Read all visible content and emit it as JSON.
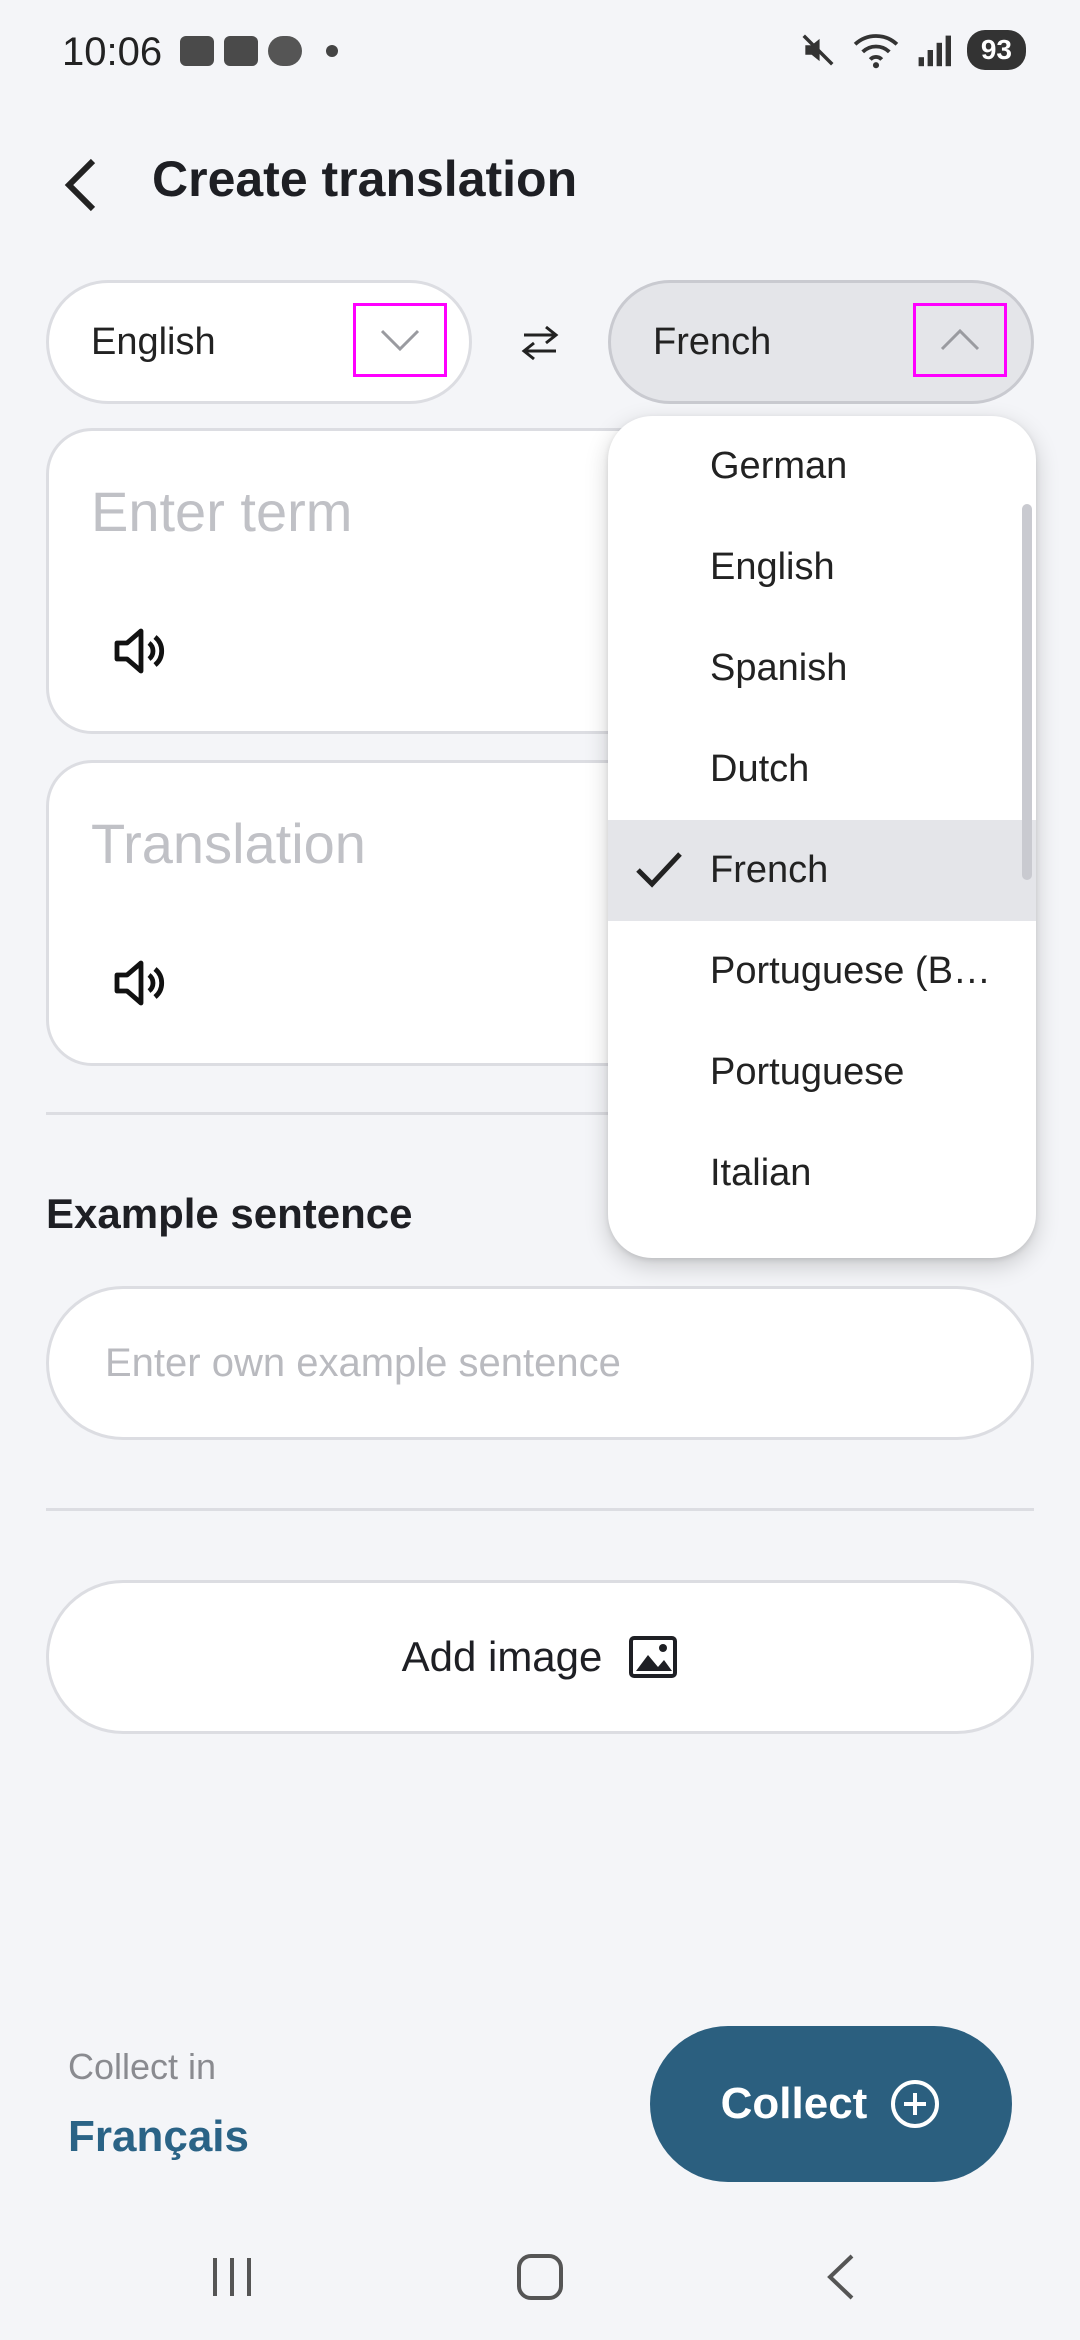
{
  "status_bar": {
    "time": "10:06",
    "battery": "93",
    "icons_left": [
      "stack-app-icon",
      "teams-icon",
      "cloud-icon",
      "dot-icon"
    ],
    "icons_right": [
      "mute-icon",
      "wifi-icon",
      "signal-icon"
    ]
  },
  "header": {
    "title": "Create translation"
  },
  "languages": {
    "source": "English",
    "target": "French"
  },
  "inputs": {
    "term_placeholder": "Enter term",
    "translation_placeholder": "Translation"
  },
  "example": {
    "section_title": "Example sentence",
    "placeholder": "Enter own example sentence"
  },
  "add_image": {
    "label": "Add image"
  },
  "dropdown": {
    "items": [
      {
        "label": "German",
        "selected": false
      },
      {
        "label": "English",
        "selected": false
      },
      {
        "label": "Spanish",
        "selected": false
      },
      {
        "label": "Dutch",
        "selected": false
      },
      {
        "label": "French",
        "selected": true
      },
      {
        "label": "Portuguese (B…",
        "selected": false
      },
      {
        "label": "Portuguese",
        "selected": false
      },
      {
        "label": "Italian",
        "selected": false
      }
    ]
  },
  "footer": {
    "collect_in_label": "Collect in",
    "collect_language": "Français",
    "collect_button": "Collect"
  },
  "colors": {
    "accent": "#2b5f7f",
    "accent_text": "#2a6386",
    "highlight_box": "#ff00ff",
    "background": "#f4f5f8"
  }
}
